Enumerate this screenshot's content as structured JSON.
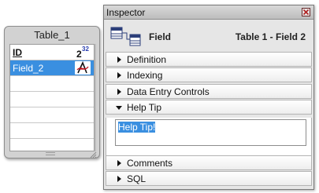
{
  "table": {
    "title": "Table_1",
    "header_field": "ID",
    "header_type_badge": "32",
    "header_type_base": "2",
    "fields": [
      {
        "name": "Field_2",
        "selected": true,
        "type_icon": "text-type-icon"
      }
    ]
  },
  "inspector": {
    "title": "Inspector",
    "kind": "Field",
    "path": "Table 1 - Field 2",
    "sections": [
      {
        "label": "Definition",
        "expanded": false
      },
      {
        "label": "Indexing",
        "expanded": false
      },
      {
        "label": "Data Entry Controls",
        "expanded": false
      },
      {
        "label": "Help Tip",
        "expanded": true
      },
      {
        "label": "Comments",
        "expanded": false
      },
      {
        "label": "SQL",
        "expanded": false
      }
    ],
    "help_tip_value": "Help Tip!"
  },
  "colors": {
    "selection": "#3a8fe0",
    "close_button_x": "#b02020"
  }
}
